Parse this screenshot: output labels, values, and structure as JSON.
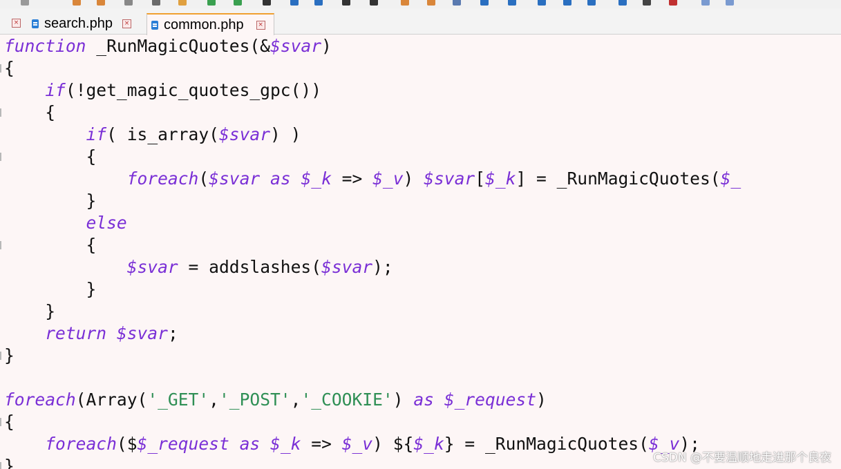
{
  "tabs": [
    {
      "label": "search.php",
      "close": "×"
    },
    {
      "label": "common.php",
      "close": "×"
    }
  ],
  "code": [
    [
      [
        "kw",
        "function"
      ],
      [
        "p",
        " _RunMagicQuotes(&"
      ],
      [
        "var",
        "$svar"
      ],
      [
        "p",
        ")"
      ]
    ],
    [
      [
        "p",
        "{"
      ]
    ],
    [
      [
        "p",
        "    "
      ],
      [
        "kw",
        "if"
      ],
      [
        "p",
        "(!get_magic_quotes_gpc())"
      ]
    ],
    [
      [
        "p",
        "    {"
      ]
    ],
    [
      [
        "p",
        "        "
      ],
      [
        "kw",
        "if"
      ],
      [
        "p",
        "( is_array("
      ],
      [
        "var",
        "$svar"
      ],
      [
        "p",
        ") )"
      ]
    ],
    [
      [
        "p",
        "        {"
      ]
    ],
    [
      [
        "p",
        "            "
      ],
      [
        "kw",
        "foreach"
      ],
      [
        "p",
        "("
      ],
      [
        "var",
        "$svar"
      ],
      [
        "p",
        " "
      ],
      [
        "kw",
        "as"
      ],
      [
        "p",
        " "
      ],
      [
        "var",
        "$_k"
      ],
      [
        "p",
        " => "
      ],
      [
        "var",
        "$_v"
      ],
      [
        "p",
        ") "
      ],
      [
        "var",
        "$svar"
      ],
      [
        "p",
        "["
      ],
      [
        "var",
        "$_k"
      ],
      [
        "p",
        "] = _RunMagicQuotes("
      ],
      [
        "var",
        "$_"
      ]
    ],
    [
      [
        "p",
        "        }"
      ]
    ],
    [
      [
        "p",
        "        "
      ],
      [
        "kw",
        "else"
      ]
    ],
    [
      [
        "p",
        "        {"
      ]
    ],
    [
      [
        "p",
        "            "
      ],
      [
        "var",
        "$svar"
      ],
      [
        "p",
        " = addslashes("
      ],
      [
        "var",
        "$svar"
      ],
      [
        "p",
        ");"
      ]
    ],
    [
      [
        "p",
        "        }"
      ]
    ],
    [
      [
        "p",
        "    }"
      ]
    ],
    [
      [
        "p",
        "    "
      ],
      [
        "kw",
        "return"
      ],
      [
        "p",
        " "
      ],
      [
        "var",
        "$svar"
      ],
      [
        "p",
        ";"
      ]
    ],
    [
      [
        "p",
        "}"
      ]
    ],
    [
      [
        "p",
        ""
      ]
    ],
    [
      [
        "kw",
        "foreach"
      ],
      [
        "p",
        "(Array("
      ],
      [
        "str",
        "'_GET'"
      ],
      [
        "p",
        ","
      ],
      [
        "str",
        "'_POST'"
      ],
      [
        "p",
        ","
      ],
      [
        "str",
        "'_COOKIE'"
      ],
      [
        "p",
        ") "
      ],
      [
        "kw",
        "as"
      ],
      [
        "p",
        " "
      ],
      [
        "var",
        "$_request"
      ],
      [
        "p",
        ")"
      ]
    ],
    [
      [
        "p",
        "{"
      ]
    ],
    [
      [
        "p",
        "    "
      ],
      [
        "kw",
        "foreach"
      ],
      [
        "p",
        "($"
      ],
      [
        "var",
        "$_request"
      ],
      [
        "p",
        " "
      ],
      [
        "kw",
        "as"
      ],
      [
        "p",
        " "
      ],
      [
        "var",
        "$_k"
      ],
      [
        "p",
        " => "
      ],
      [
        "var",
        "$_v"
      ],
      [
        "p",
        ") ${"
      ],
      [
        "var",
        "$_k"
      ],
      [
        "p",
        "} = _RunMagicQuotes("
      ],
      [
        "var",
        "$_v"
      ],
      [
        "p",
        ");"
      ]
    ],
    [
      [
        "p",
        "}"
      ]
    ]
  ],
  "watermark": "CSDN @不要温顺地走进那个良夜",
  "colors": {
    "keyword": "#7a2fd6",
    "string": "#2f8f55",
    "background": "#fdf6f6",
    "active_tab_accent": "#f0a030"
  }
}
